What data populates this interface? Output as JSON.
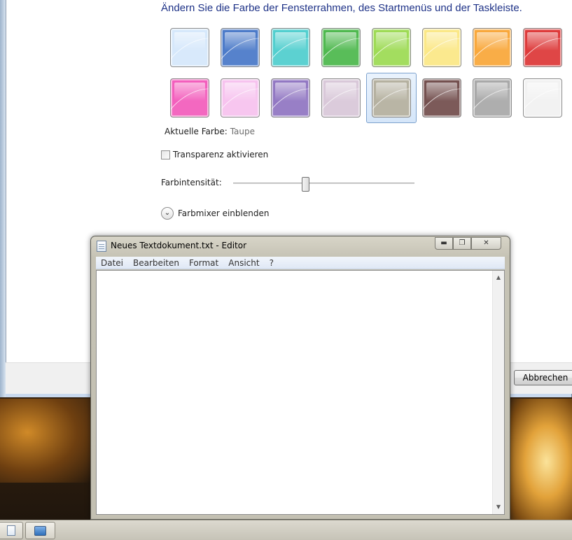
{
  "personalization": {
    "heading": "Ändern Sie die Farbe der Fensterrahmen, des Startmenüs und der Taskleiste.",
    "current_color_label": "Aktuelle Farbe:",
    "current_color_value": "Taupe",
    "selected_swatch_index": 12,
    "swatches": [
      {
        "color": "#d6e8fb"
      },
      {
        "color": "#4c7bc9"
      },
      {
        "color": "#52cfcf"
      },
      {
        "color": "#4fb94f"
      },
      {
        "color": "#9edb55"
      },
      {
        "color": "#fbe887"
      },
      {
        "color": "#f9a83c"
      },
      {
        "color": "#de3b3b"
      },
      {
        "color": "#f35fbd"
      },
      {
        "color": "#f7c3ef"
      },
      {
        "color": "#9278c3"
      },
      {
        "color": "#d9c8d9"
      },
      {
        "color": "#b5b1a0"
      },
      {
        "color": "#74504f"
      },
      {
        "color": "#a9a9a9"
      },
      {
        "color": "#f2f2f2"
      }
    ],
    "transparency_label": "Transparenz aktivieren",
    "transparency_checked": false,
    "intensity_label": "Farbintensität:",
    "intensity_value": 0.4,
    "mixer_label": "Farbmixer einblenden",
    "cancel_label": "Abbrechen"
  },
  "notepad": {
    "title": "Neues Textdokument.txt - Editor",
    "menu": [
      "Datei",
      "Bearbeiten",
      "Format",
      "Ansicht",
      "?"
    ],
    "content": ""
  },
  "icons": {
    "minimize": "minimize-icon",
    "maximize": "maximize-icon",
    "close": "close-icon",
    "chevron": "chevron-down-icon"
  }
}
